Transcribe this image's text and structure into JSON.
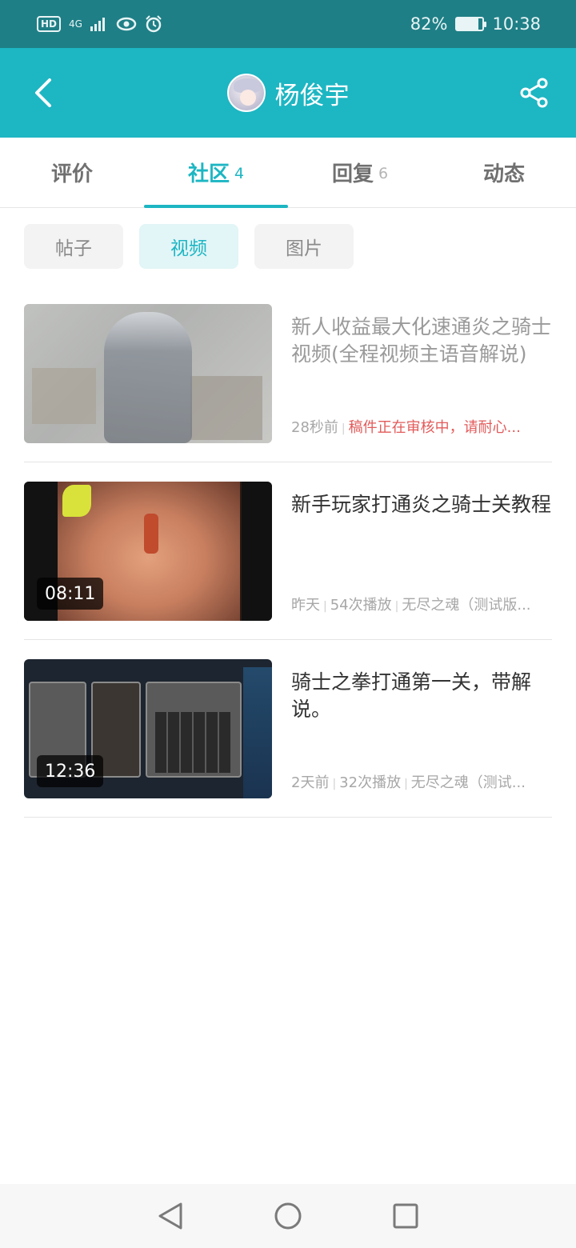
{
  "status_bar": {
    "hd": "HD",
    "network": "4G",
    "battery_percent": "82%",
    "battery_level": 0.82,
    "time": "10:38"
  },
  "header": {
    "username": "杨俊宇",
    "icons": [
      "back-arrow-icon",
      "share-icon"
    ]
  },
  "tabs": [
    {
      "label": "评价",
      "count": ""
    },
    {
      "label": "社区",
      "count": "4",
      "active": true
    },
    {
      "label": "回复",
      "count": "6"
    },
    {
      "label": "动态",
      "count": ""
    }
  ],
  "chips": [
    {
      "label": "帖子"
    },
    {
      "label": "视频",
      "active": true
    },
    {
      "label": "图片"
    }
  ],
  "videos": [
    {
      "title": "新人收益最大化速通炎之骑士视频(全程视频主语音解说)",
      "time": "28秒前",
      "status": "稿件正在审核中，请耐心..."
    },
    {
      "title": "新手玩家打通炎之骑士关教程",
      "duration": "08:11",
      "time": "昨天",
      "plays": "54次播放",
      "game": "无尽之魂（测试版..."
    },
    {
      "title": "骑士之拳打通第一关，带解说。",
      "duration": "12:36",
      "time": "2天前",
      "plays": "32次播放",
      "game": "无尽之魂（测试..."
    }
  ],
  "colors": {
    "accent": "#1db6c3",
    "status_bar": "#1f7f86",
    "warning": "#e25b5b"
  }
}
